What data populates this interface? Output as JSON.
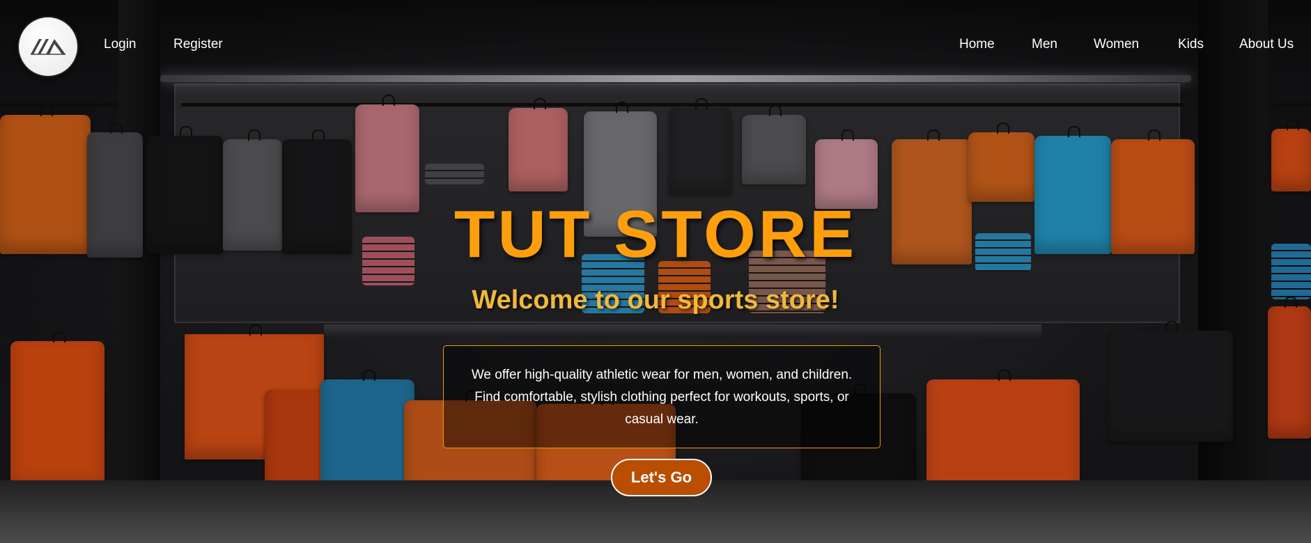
{
  "nav": {
    "logo_icon": "store-logo-icon",
    "left_links": [
      {
        "label": "Login"
      },
      {
        "label": "Register"
      }
    ],
    "right_links": [
      {
        "label": "Home"
      },
      {
        "label": "Men"
      },
      {
        "label": "Women"
      },
      {
        "label": "Kids"
      },
      {
        "label": "About Us"
      }
    ]
  },
  "hero": {
    "title": "TUT STORE",
    "subtitle": "Welcome to our sports store!",
    "description_lines": [
      "We offer high-quality athletic wear for men, women, and children.",
      "Find comfortable, stylish clothing perfect for workouts, sports, or",
      "casual wear."
    ],
    "cta_label": "Let's Go"
  },
  "colors": {
    "title": "#ff9e0d",
    "subtitle": "#f0b83c",
    "box_border": "#f29a12",
    "cta_background": "#b94d00"
  }
}
